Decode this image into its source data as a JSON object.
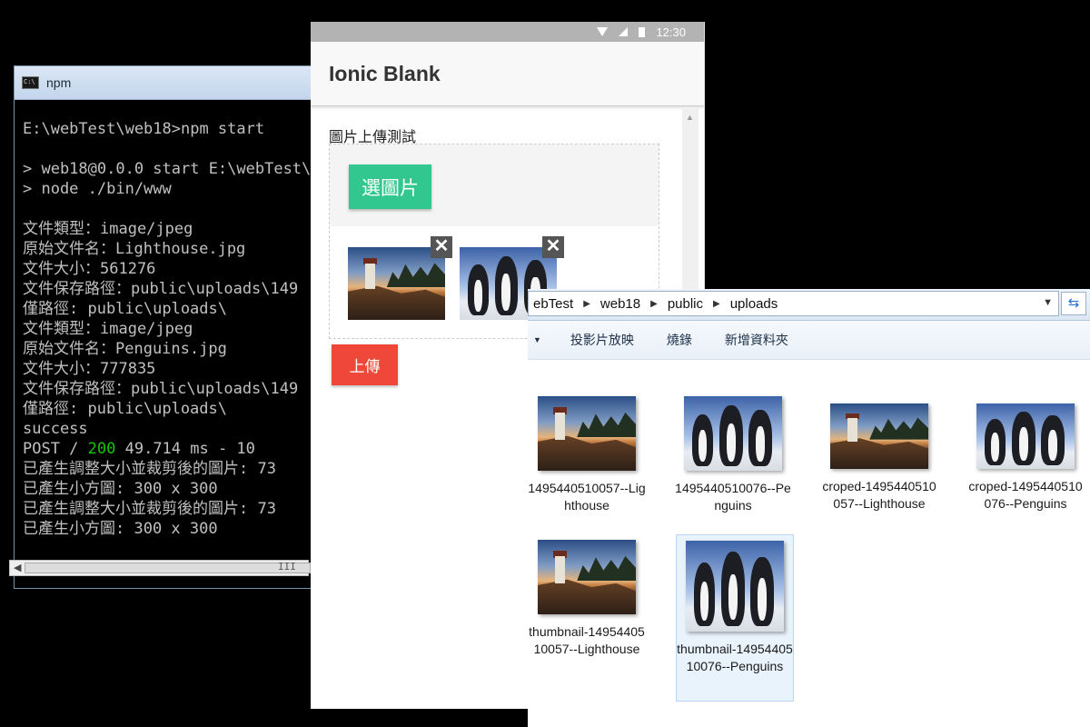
{
  "cmd": {
    "title": "npm",
    "lines": [
      "E:\\webTest\\web18>npm start",
      "",
      "> web18@0.0.0 start E:\\webTest\\",
      "> node ./bin/www",
      "",
      "文件類型：image/jpeg",
      "原始文件名：Lighthouse.jpg",
      "文件大小：561276",
      "文件保存路徑：public\\uploads\\149",
      "僅路徑: public\\uploads\\",
      "文件類型：image/jpeg",
      "原始文件名：Penguins.jpg",
      "文件大小：777835",
      "文件保存路徑：public\\uploads\\149",
      "僅路徑: public\\uploads\\",
      "success",
      "POST / ",
      "已產生調整大小並裁剪後的圖片: 73",
      "已產生小方圖: 300 x 300",
      "已產生調整大小並裁剪後的圖片: 73",
      "已產生小方圖: 300 x 300"
    ],
    "post_status": "200",
    "post_tail": " 49.714 ms - 10",
    "status_color": "#16c60c"
  },
  "phone": {
    "time": "12:30",
    "header_title": "Ionic Blank",
    "label": "圖片上傳測試",
    "pick_button": "選圖片",
    "pick_color": "#32c78f",
    "upload_button": "上傳",
    "upload_color": "#ef473a",
    "close_glyph": "✕"
  },
  "explorer": {
    "breadcrumb": [
      "ebTest",
      "web18",
      "public",
      "uploads"
    ],
    "toolbar": [
      "投影片放映",
      "燒錄",
      "新增資料夾"
    ],
    "files": [
      {
        "name": "1495440510057--Lighthouse",
        "image": "lighthouse"
      },
      {
        "name": "1495440510076--Penguins",
        "image": "penguins"
      },
      {
        "name": "croped-1495440510057--Lighthouse",
        "image": "lighthouse"
      },
      {
        "name": "croped-1495440510076--Penguins",
        "image": "penguins"
      },
      {
        "name": "thumbnail-1495440510057--Lighthouse",
        "image": "lighthouse"
      },
      {
        "name": "thumbnail-1495440510076--Penguins",
        "image": "penguins"
      }
    ]
  }
}
